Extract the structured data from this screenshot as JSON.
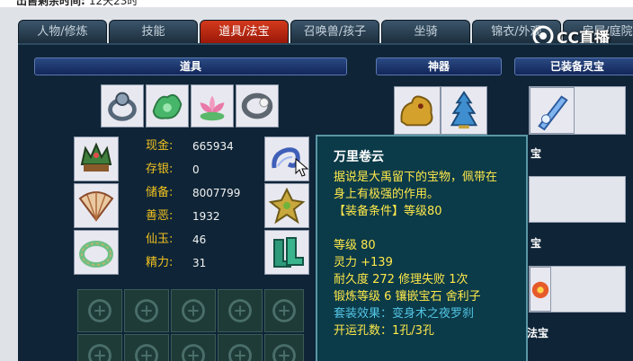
{
  "header": {
    "label": "出售剩余时间:",
    "value": "12天23时"
  },
  "tabs": [
    {
      "label": "人物/修炼"
    },
    {
      "label": "技能"
    },
    {
      "label": "道具/法宝"
    },
    {
      "label": "召唤兽/孩子"
    },
    {
      "label": "坐骑"
    },
    {
      "label": "锦衣/外观"
    },
    {
      "label": "房屋/庭院"
    }
  ],
  "sections": {
    "daoju": "道具",
    "shenqi": "神器",
    "equipped_lingbao": "已装备灵宝",
    "right_partial_1": "宝",
    "right_partial_2": "宝",
    "right_partial_3": "法宝"
  },
  "stats": [
    {
      "label": "现金:",
      "value": "665934"
    },
    {
      "label": "存银:",
      "value": "0"
    },
    {
      "label": "储备:",
      "value": "8007799"
    },
    {
      "label": "善恶:",
      "value": "1932"
    },
    {
      "label": "仙玉:",
      "value": "46"
    },
    {
      "label": "精力:",
      "value": "31"
    }
  ],
  "tooltip": {
    "name": "万里卷云",
    "desc_line1": "据说是大禹留下的宝物，佩带在",
    "desc_line2": "身上有极强的作用。",
    "requirement": "【装备条件】等级80",
    "level": "等级 80",
    "lingli": "灵力 +139",
    "durability": "耐久度 272 修理失败 1次",
    "forge": "锻炼等级 6 镶嵌宝石 舍利子",
    "set_effect": "套装效果：变身术之夜罗刹",
    "holes": "开运孔数：1孔/3孔"
  },
  "watermark": {
    "text": "CC直播"
  },
  "colors": {
    "tab_active": "#c42a14",
    "panel_bg": "#0f2537",
    "stat_label": "#f0c020",
    "tooltip_bg": "#0b3a48",
    "tooltip_yellow": "#ffe94a",
    "tooltip_cyan": "#53c6e6"
  }
}
